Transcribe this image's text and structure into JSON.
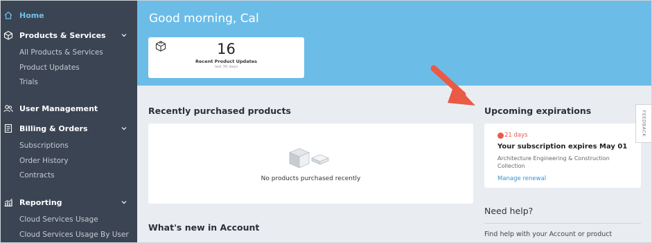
{
  "sidebar": {
    "home": "Home",
    "products": {
      "label": "Products & Services",
      "items": [
        "All Products & Services",
        "Product Updates",
        "Trials"
      ]
    },
    "user_management": "User Management",
    "billing": {
      "label": "Billing & Orders",
      "items": [
        "Subscriptions",
        "Order History",
        "Contracts"
      ]
    },
    "reporting": {
      "label": "Reporting",
      "items": [
        "Cloud Services Usage",
        "Cloud Services Usage By User"
      ]
    }
  },
  "header": {
    "greeting": "Good morning, Cal",
    "stat": {
      "number": "16",
      "label": "Recent Product Updates",
      "sub": "last 30 days"
    }
  },
  "main": {
    "recent_title": "Recently purchased products",
    "recent_empty": "No products purchased recently",
    "whats_new_title": "What's new in Account"
  },
  "expirations": {
    "title": "Upcoming expirations",
    "days": "21 days",
    "headline": "Your subscription expires May 01",
    "product": "Architecture Engineering & Construction Collection",
    "link": "Manage renewal"
  },
  "help": {
    "title": "Need help?",
    "text": "Find help with your Account or product"
  },
  "feedback": "FEEDBACK",
  "colors": {
    "sidebar_bg": "#3b4452",
    "header_bg": "#6bbde8",
    "active": "#6cc3ef",
    "alert": "#e85a4f",
    "link": "#3c8fd6",
    "arrow": "#ea5a45"
  }
}
